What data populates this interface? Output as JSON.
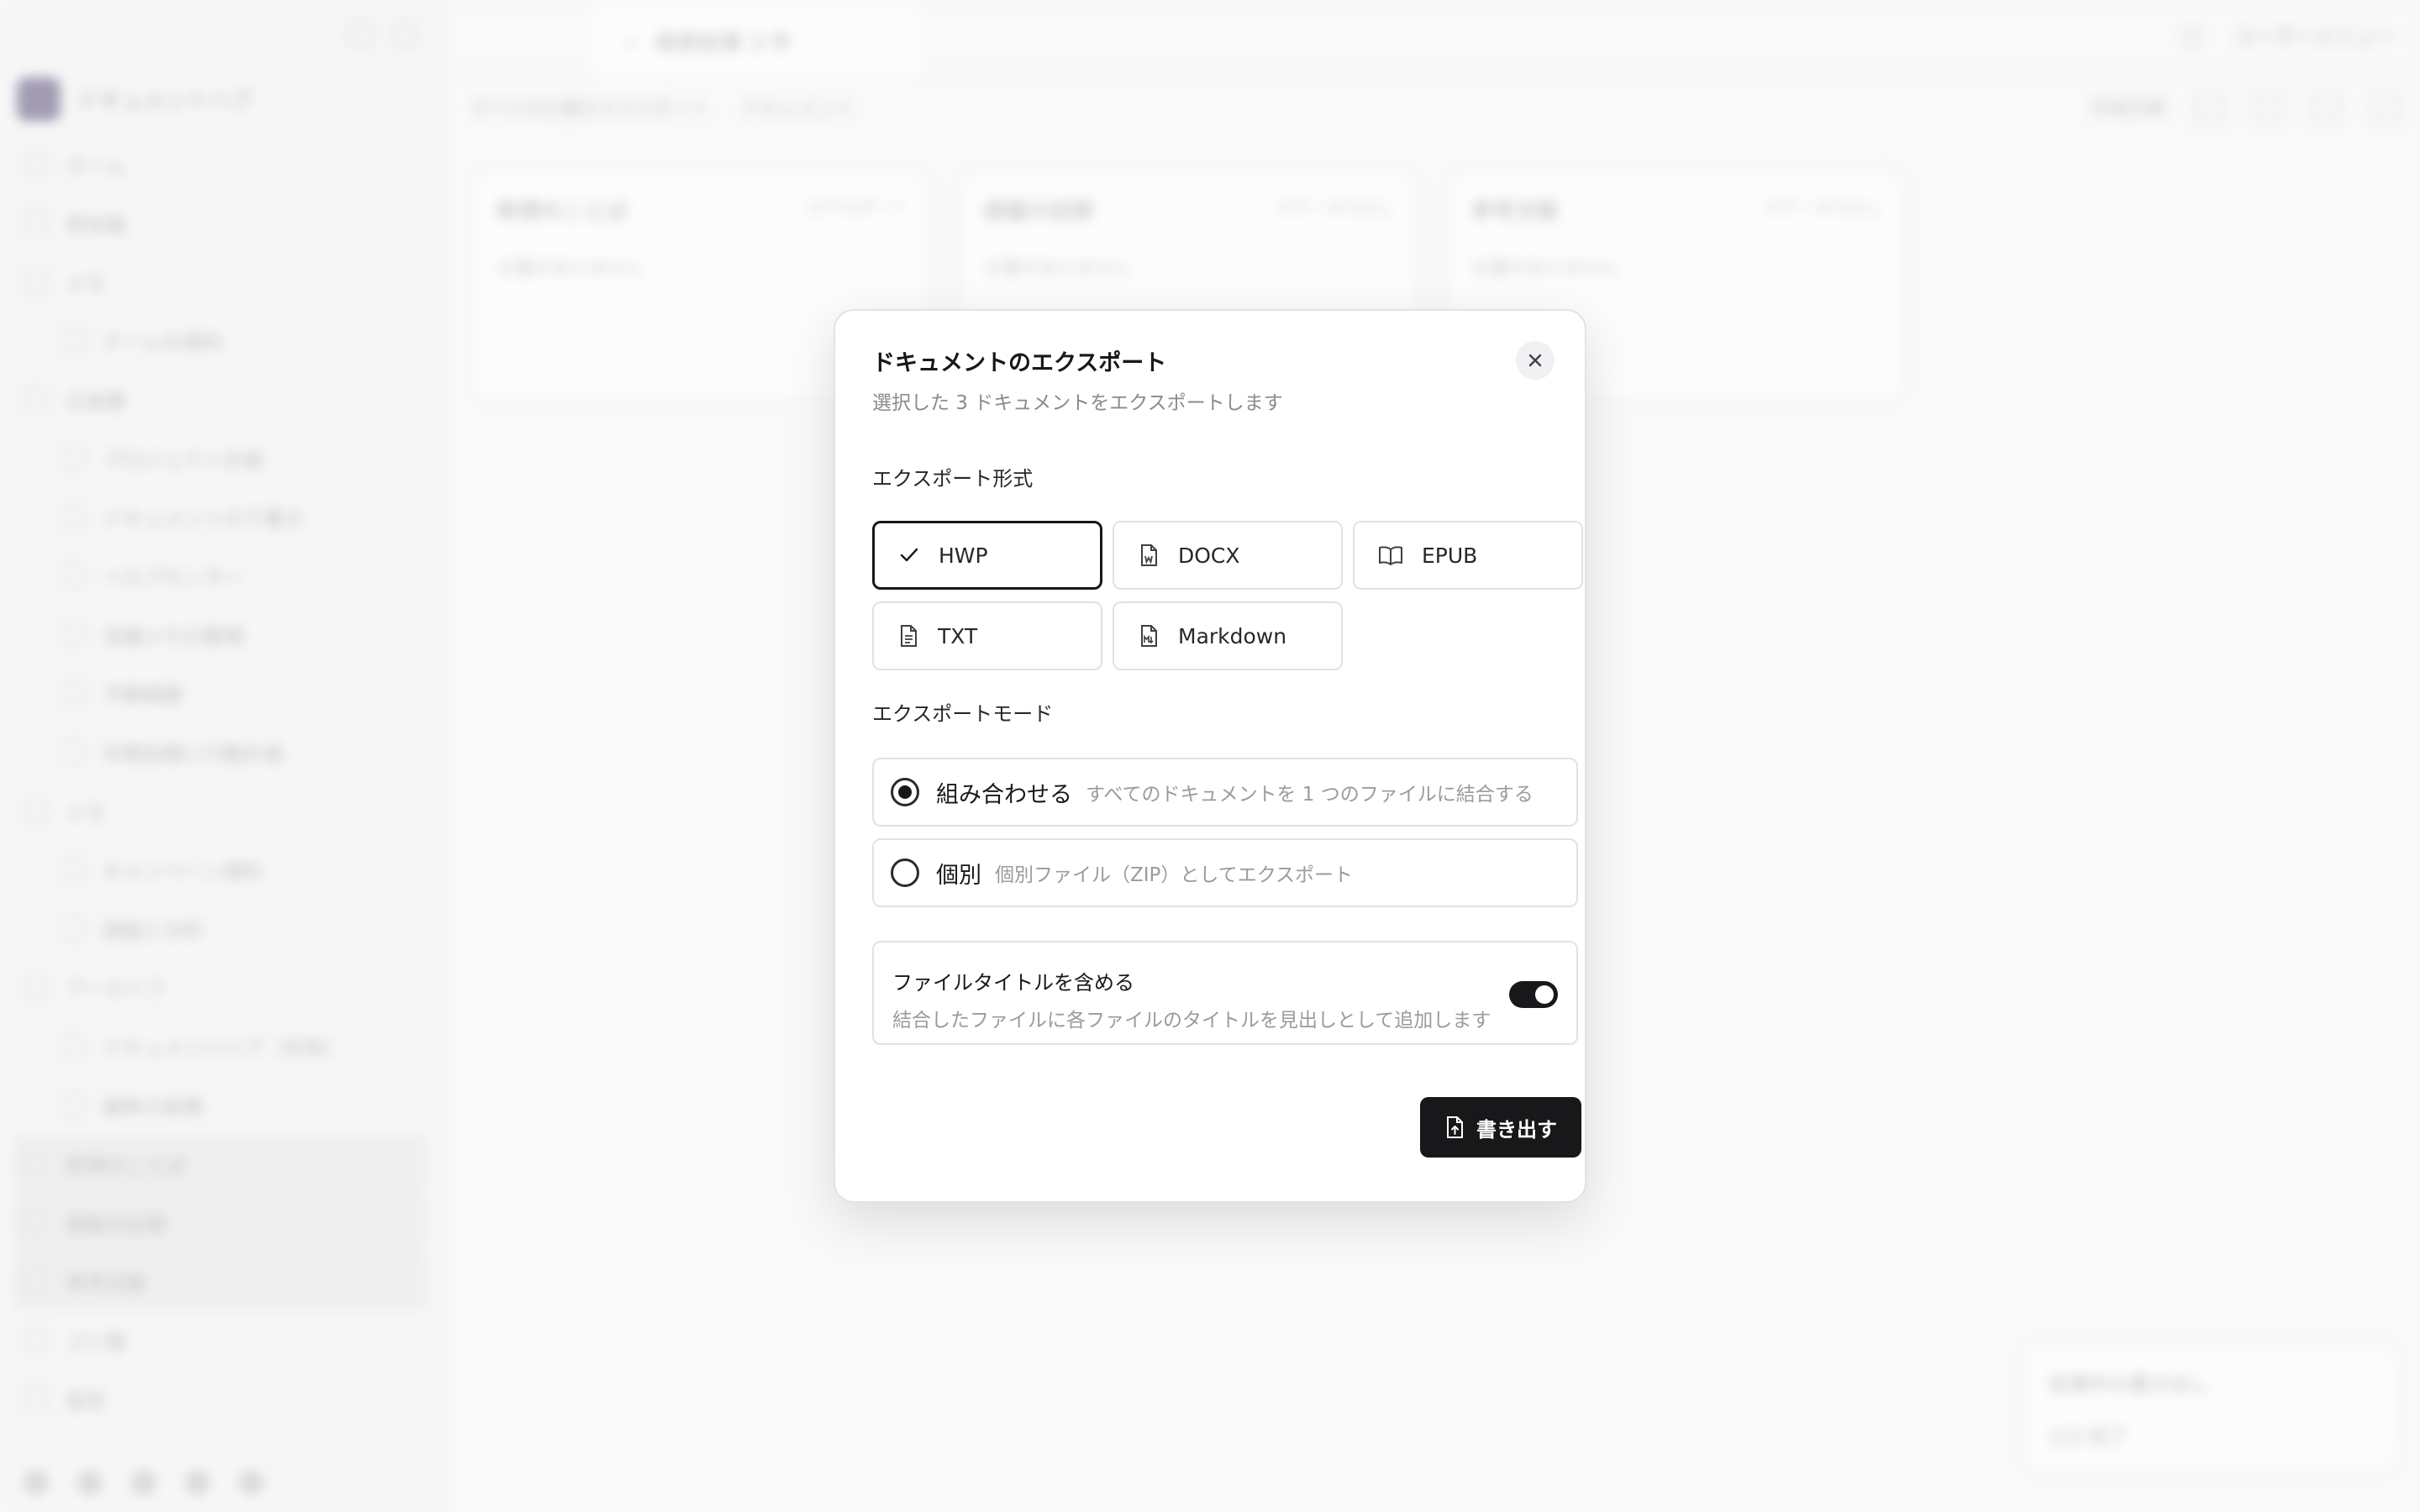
{
  "background": {
    "workspace_name": "ドキュメントハブ",
    "sidebar_items": [
      {
        "label": "ホーム",
        "sub": false
      },
      {
        "label": "受信箱",
        "sub": false
      },
      {
        "label": "メモ",
        "sub": false
      },
      {
        "label": "チームの資料",
        "sub": true
      },
      {
        "label": "企画書",
        "sub": false
      },
      {
        "label": "プロジェクト計画",
        "sub": true
      },
      {
        "label": "ドキュメントの下書き",
        "sub": true
      },
      {
        "label": "ヘルプセンター",
        "sub": true
      },
      {
        "label": "会議メモの整理",
        "sub": true
      },
      {
        "label": "予算概要",
        "sub": true
      },
      {
        "label": "年間目標と行動計画",
        "sub": true
      },
      {
        "label": "メモ",
        "sub": false
      },
      {
        "label": "キャンペーン資料",
        "sub": true
      },
      {
        "label": "調査と分析",
        "sub": true
      },
      {
        "label": "アーカイブ",
        "sub": false
      },
      {
        "label": "ドキュメントハブ（共有）",
        "sub": true
      },
      {
        "label": "最新の投稿",
        "sub": true
      },
      {
        "label": "新規のことば",
        "sub": false,
        "hl": true
      },
      {
        "label": "調査の記録",
        "sub": false,
        "hl": true
      },
      {
        "label": "参考文献",
        "sub": false,
        "hl": true
      },
      {
        "label": "ゴミ箱",
        "sub": false
      },
      {
        "label": "設定",
        "sub": false
      }
    ],
    "tab_title": "検索結果 3 件",
    "topbar_right": "ユーザーメニュー",
    "breadcrumb": [
      "すべての文書をエクスポート",
      "ドキュメント"
    ],
    "sort_label": "作成日順",
    "cards": [
      {
        "title": "新規のことば",
        "meta": "エクスポート",
        "sub": "文書がありません"
      },
      {
        "title": "調査の記録",
        "meta": "ステータスなし",
        "sub": "文書がありません"
      },
      {
        "title": "参考文献",
        "meta": "ステータスなし",
        "sub": "文書がありません"
      }
    ],
    "toast": {
      "title": "処理中の書き出し",
      "item": "1/3 完了"
    }
  },
  "dialog": {
    "title": "ドキュメントのエクスポート",
    "subtitle": "選択した 3 ドキュメントをエクスポートします",
    "format_section": "エクスポート形式",
    "formats": [
      {
        "label": "HWP",
        "icon": "check-icon",
        "selected": true
      },
      {
        "label": "DOCX",
        "icon": "file-word-icon",
        "selected": false
      },
      {
        "label": "EPUB",
        "icon": "book-open-icon",
        "selected": false
      },
      {
        "label": "TXT",
        "icon": "file-text-icon",
        "selected": false
      },
      {
        "label": "Markdown",
        "icon": "file-markdown-icon",
        "selected": false
      }
    ],
    "mode_section": "エクスポートモード",
    "modes": [
      {
        "label": "組み合わせる",
        "desc": "すべてのドキュメントを 1 つのファイルに結合する",
        "selected": true
      },
      {
        "label": "個別",
        "desc": "個別ファイル（ZIP）としてエクスポート",
        "selected": false
      }
    ],
    "include_title": {
      "label": "ファイルタイトルを含める",
      "desc": "結合したファイルに各ファイルのタイトルを見出しとして追加します",
      "enabled": true
    },
    "export_button": "書き出す"
  }
}
